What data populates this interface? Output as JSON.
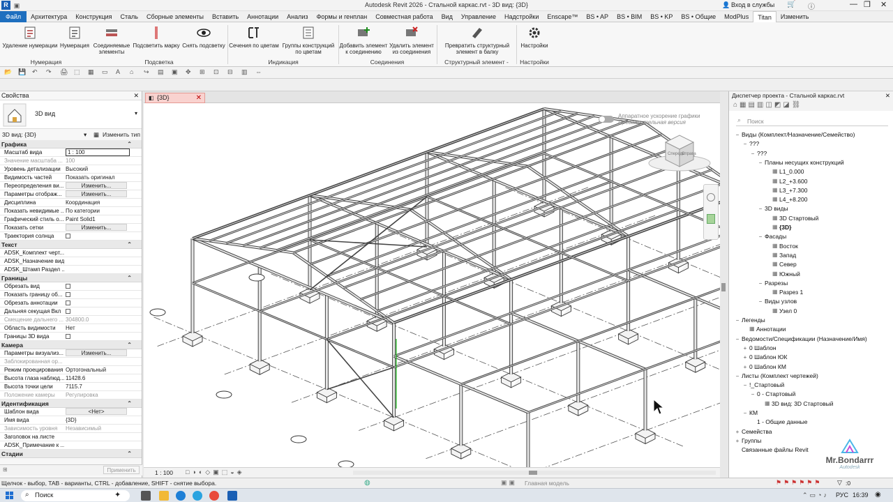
{
  "app": {
    "title": "Autodesk Revit 2026 - Стальной каркас.rvt - 3D вид: {3D}",
    "signin": "Вход в службы",
    "logo_letter": "R"
  },
  "menu": [
    "Файл",
    "Архитектура",
    "Конструкция",
    "Сталь",
    "Сборные элементы",
    "Вставить",
    "Аннотации",
    "Анализ",
    "Формы и генплан",
    "Совместная работа",
    "Вид",
    "Управление",
    "Надстройки",
    "Enscape™",
    "BS • AP",
    "BS • BIM",
    "BS • KP",
    "BS • Общие",
    "ModPlus",
    "Titan",
    "Изменить"
  ],
  "ribbon": {
    "buttons": [
      {
        "label": "Удаление нумерации",
        "icon": "remove-numbering-icon"
      },
      {
        "label": "Нумерация",
        "icon": "numbering-icon"
      },
      {
        "label": "Соединяемые элементы",
        "icon": "joined-elements-icon"
      },
      {
        "label": "Подсветить марку",
        "icon": "highlight-mark-icon"
      },
      {
        "label": "Снять подсветку",
        "icon": "eye-icon"
      },
      {
        "label": "Сечения по цветам",
        "icon": "sections-by-color-icon"
      },
      {
        "label": "Группы конструкций по цветам",
        "icon": "groups-by-color-icon"
      },
      {
        "label": "Добавить элемент к соединению",
        "icon": "add-to-joint-icon"
      },
      {
        "label": "Удалить элемент из соединения",
        "icon": "remove-from-joint-icon"
      },
      {
        "label": "Превратить структурный элемент в балку",
        "icon": "convert-to-beam-icon"
      },
      {
        "label": "Настройки",
        "icon": "gear-icon"
      }
    ],
    "groups": [
      "Нумерация",
      "Подсветка",
      "Индикация",
      "Соединения",
      "Структурный элемент - Балка",
      "Настройки"
    ]
  },
  "props": {
    "title": "Свойства",
    "type_name": "3D вид",
    "selector": "3D вид: {3D}",
    "edit_type": "Изменить тип",
    "sections": [
      {
        "name": "Графика",
        "rows": [
          {
            "k": "Масштаб вида",
            "v": "1 : 100",
            "kind": "input"
          },
          {
            "k": "Значение масштаба ...",
            "v": "100",
            "kind": "dis"
          },
          {
            "k": "Уровень детализации",
            "v": "Высокий"
          },
          {
            "k": "Видимость частей",
            "v": "Показать оригинал"
          },
          {
            "k": "Переопределения ви...",
            "v": "Изменить...",
            "kind": "btn"
          },
          {
            "k": "Параметры отображ...",
            "v": "Изменить...",
            "kind": "btn"
          },
          {
            "k": "Дисциплина",
            "v": "Координация"
          },
          {
            "k": "Показать невидимые ...",
            "v": "По категории"
          },
          {
            "k": "Графический стиль о...",
            "v": "Paint Solid1"
          },
          {
            "k": "Показать сетки",
            "v": "Изменить...",
            "kind": "btn"
          },
          {
            "k": "Траектория солнца",
            "v": "",
            "kind": "chk"
          }
        ]
      },
      {
        "name": "Текст",
        "rows": [
          {
            "k": "ADSK_Комплект черт...",
            "v": ""
          },
          {
            "k": "ADSK_Назначение вида",
            "v": ""
          },
          {
            "k": "ADSK_Штамп Раздел ...",
            "v": ""
          }
        ]
      },
      {
        "name": "Границы",
        "rows": [
          {
            "k": "Обрезать вид",
            "v": "",
            "kind": "chk"
          },
          {
            "k": "Показать границу об...",
            "v": "",
            "kind": "chk"
          },
          {
            "k": "Обрезать аннотации",
            "v": "",
            "kind": "chk"
          },
          {
            "k": "Дальняя секущая Вкл",
            "v": "",
            "kind": "chk"
          },
          {
            "k": "Смещение дальнего ...",
            "v": "304800.0",
            "kind": "dis"
          },
          {
            "k": "Область видимости",
            "v": "Нет"
          },
          {
            "k": "Границы 3D вида",
            "v": "",
            "kind": "chk"
          }
        ]
      },
      {
        "name": "Камера",
        "rows": [
          {
            "k": "Параметры визуализ...",
            "v": "Изменить...",
            "kind": "btn"
          },
          {
            "k": "Заблокированная ор...",
            "v": "",
            "kind": "dis"
          },
          {
            "k": "Режим проецирования",
            "v": "Ортогональный"
          },
          {
            "k": "Высота глаза наблюд...",
            "v": "11428.6"
          },
          {
            "k": "Высота точки цели",
            "v": "7115.7"
          },
          {
            "k": "Положение камеры",
            "v": "Регулировка",
            "kind": "dis"
          }
        ]
      },
      {
        "name": "Идентификация",
        "rows": [
          {
            "k": "Шаблон вида",
            "v": "<Нет>",
            "kind": "btn"
          },
          {
            "k": "Имя вида",
            "v": "{3D}"
          },
          {
            "k": "Зависимость уровня",
            "v": "Независимый",
            "kind": "dis"
          },
          {
            "k": "Заголовок на листе",
            "v": ""
          },
          {
            "k": "ADSK_Примечание к ...",
            "v": ""
          }
        ]
      },
      {
        "name": "Стадии",
        "rows": []
      }
    ],
    "apply": "Применить"
  },
  "view": {
    "tab": "{3D}",
    "hw_accel_1": "Аппаратное ускорение графики",
    "hw_accel_2": "Предварительная версия",
    "scale": "1 : 100",
    "model": "Главная модель",
    "viewcube_front": "Спереди",
    "viewcube_right": "Справа"
  },
  "browser": {
    "title": "Диспетчер проекта - Стальной каркас.rvt",
    "search": "Поиск",
    "tree": [
      {
        "t": "Виды (Комплект/Назначение/Семейство)",
        "d": 0,
        "m": "-"
      },
      {
        "t": "???",
        "d": 1,
        "m": "-"
      },
      {
        "t": "???",
        "d": 2,
        "m": "-"
      },
      {
        "t": "Планы несущих конструкций",
        "d": 3,
        "m": "-"
      },
      {
        "t": "L1_0.000",
        "d": 4,
        "i": 1
      },
      {
        "t": "L2_+3.600",
        "d": 4,
        "i": 1
      },
      {
        "t": "L3_+7.300",
        "d": 4,
        "i": 1
      },
      {
        "t": "L4_+8.200",
        "d": 4,
        "i": 1
      },
      {
        "t": "3D виды",
        "d": 3,
        "m": "-"
      },
      {
        "t": "3D Стартовый",
        "d": 4,
        "i": 1
      },
      {
        "t": "{3D}",
        "d": 4,
        "i": 1,
        "b": 1
      },
      {
        "t": "Фасады",
        "d": 3,
        "m": "-"
      },
      {
        "t": "Восток",
        "d": 4,
        "i": 1
      },
      {
        "t": "Запад",
        "d": 4,
        "i": 1
      },
      {
        "t": "Север",
        "d": 4,
        "i": 1
      },
      {
        "t": "Южный",
        "d": 4,
        "i": 1
      },
      {
        "t": "Разрезы",
        "d": 3,
        "m": "-"
      },
      {
        "t": "Разрез 1",
        "d": 4,
        "i": 1
      },
      {
        "t": "Виды узлов",
        "d": 3,
        "m": "-"
      },
      {
        "t": "Узел 0",
        "d": 4,
        "i": 1
      },
      {
        "t": "Легенды",
        "d": 0,
        "m": "-"
      },
      {
        "t": "Аннотации",
        "d": 1,
        "i": 1
      },
      {
        "t": "Ведомости/Спецификации (Назначение/Имя)",
        "d": 0,
        "m": "-"
      },
      {
        "t": "0 Шаблон",
        "d": 1,
        "m": "+"
      },
      {
        "t": "0 Шаблон ЮК",
        "d": 1,
        "m": "+"
      },
      {
        "t": "0 Шаблон КМ",
        "d": 1,
        "m": "+"
      },
      {
        "t": "Листы (Комплект чертежей)",
        "d": 0,
        "m": "-"
      },
      {
        "t": "!_Стартовый",
        "d": 1,
        "m": "-"
      },
      {
        "t": "0 - Стартовый",
        "d": 2,
        "m": "-"
      },
      {
        "t": "3D вид: 3D Стартовый",
        "d": 3,
        "i": 1
      },
      {
        "t": "КМ",
        "d": 1,
        "m": "-"
      },
      {
        "t": "1 - Общие данные",
        "d": 2
      },
      {
        "t": "Семейства",
        "d": 0,
        "m": "+"
      },
      {
        "t": "Группы",
        "d": 0,
        "m": "+"
      },
      {
        "t": "Связанные файлы Revit",
        "d": 0
      }
    ],
    "watermark": "Mr.Bondarrr",
    "watermark_sub": "Autodesk"
  },
  "status": {
    "hint": "Щелчок - выбор, TAB - варианты, CTRL - добавление, SHIFT - снятие выбора.",
    "filter": ":0"
  },
  "taskbar": {
    "search": "Поиск",
    "lang": "РУС",
    "time": "16:39"
  }
}
